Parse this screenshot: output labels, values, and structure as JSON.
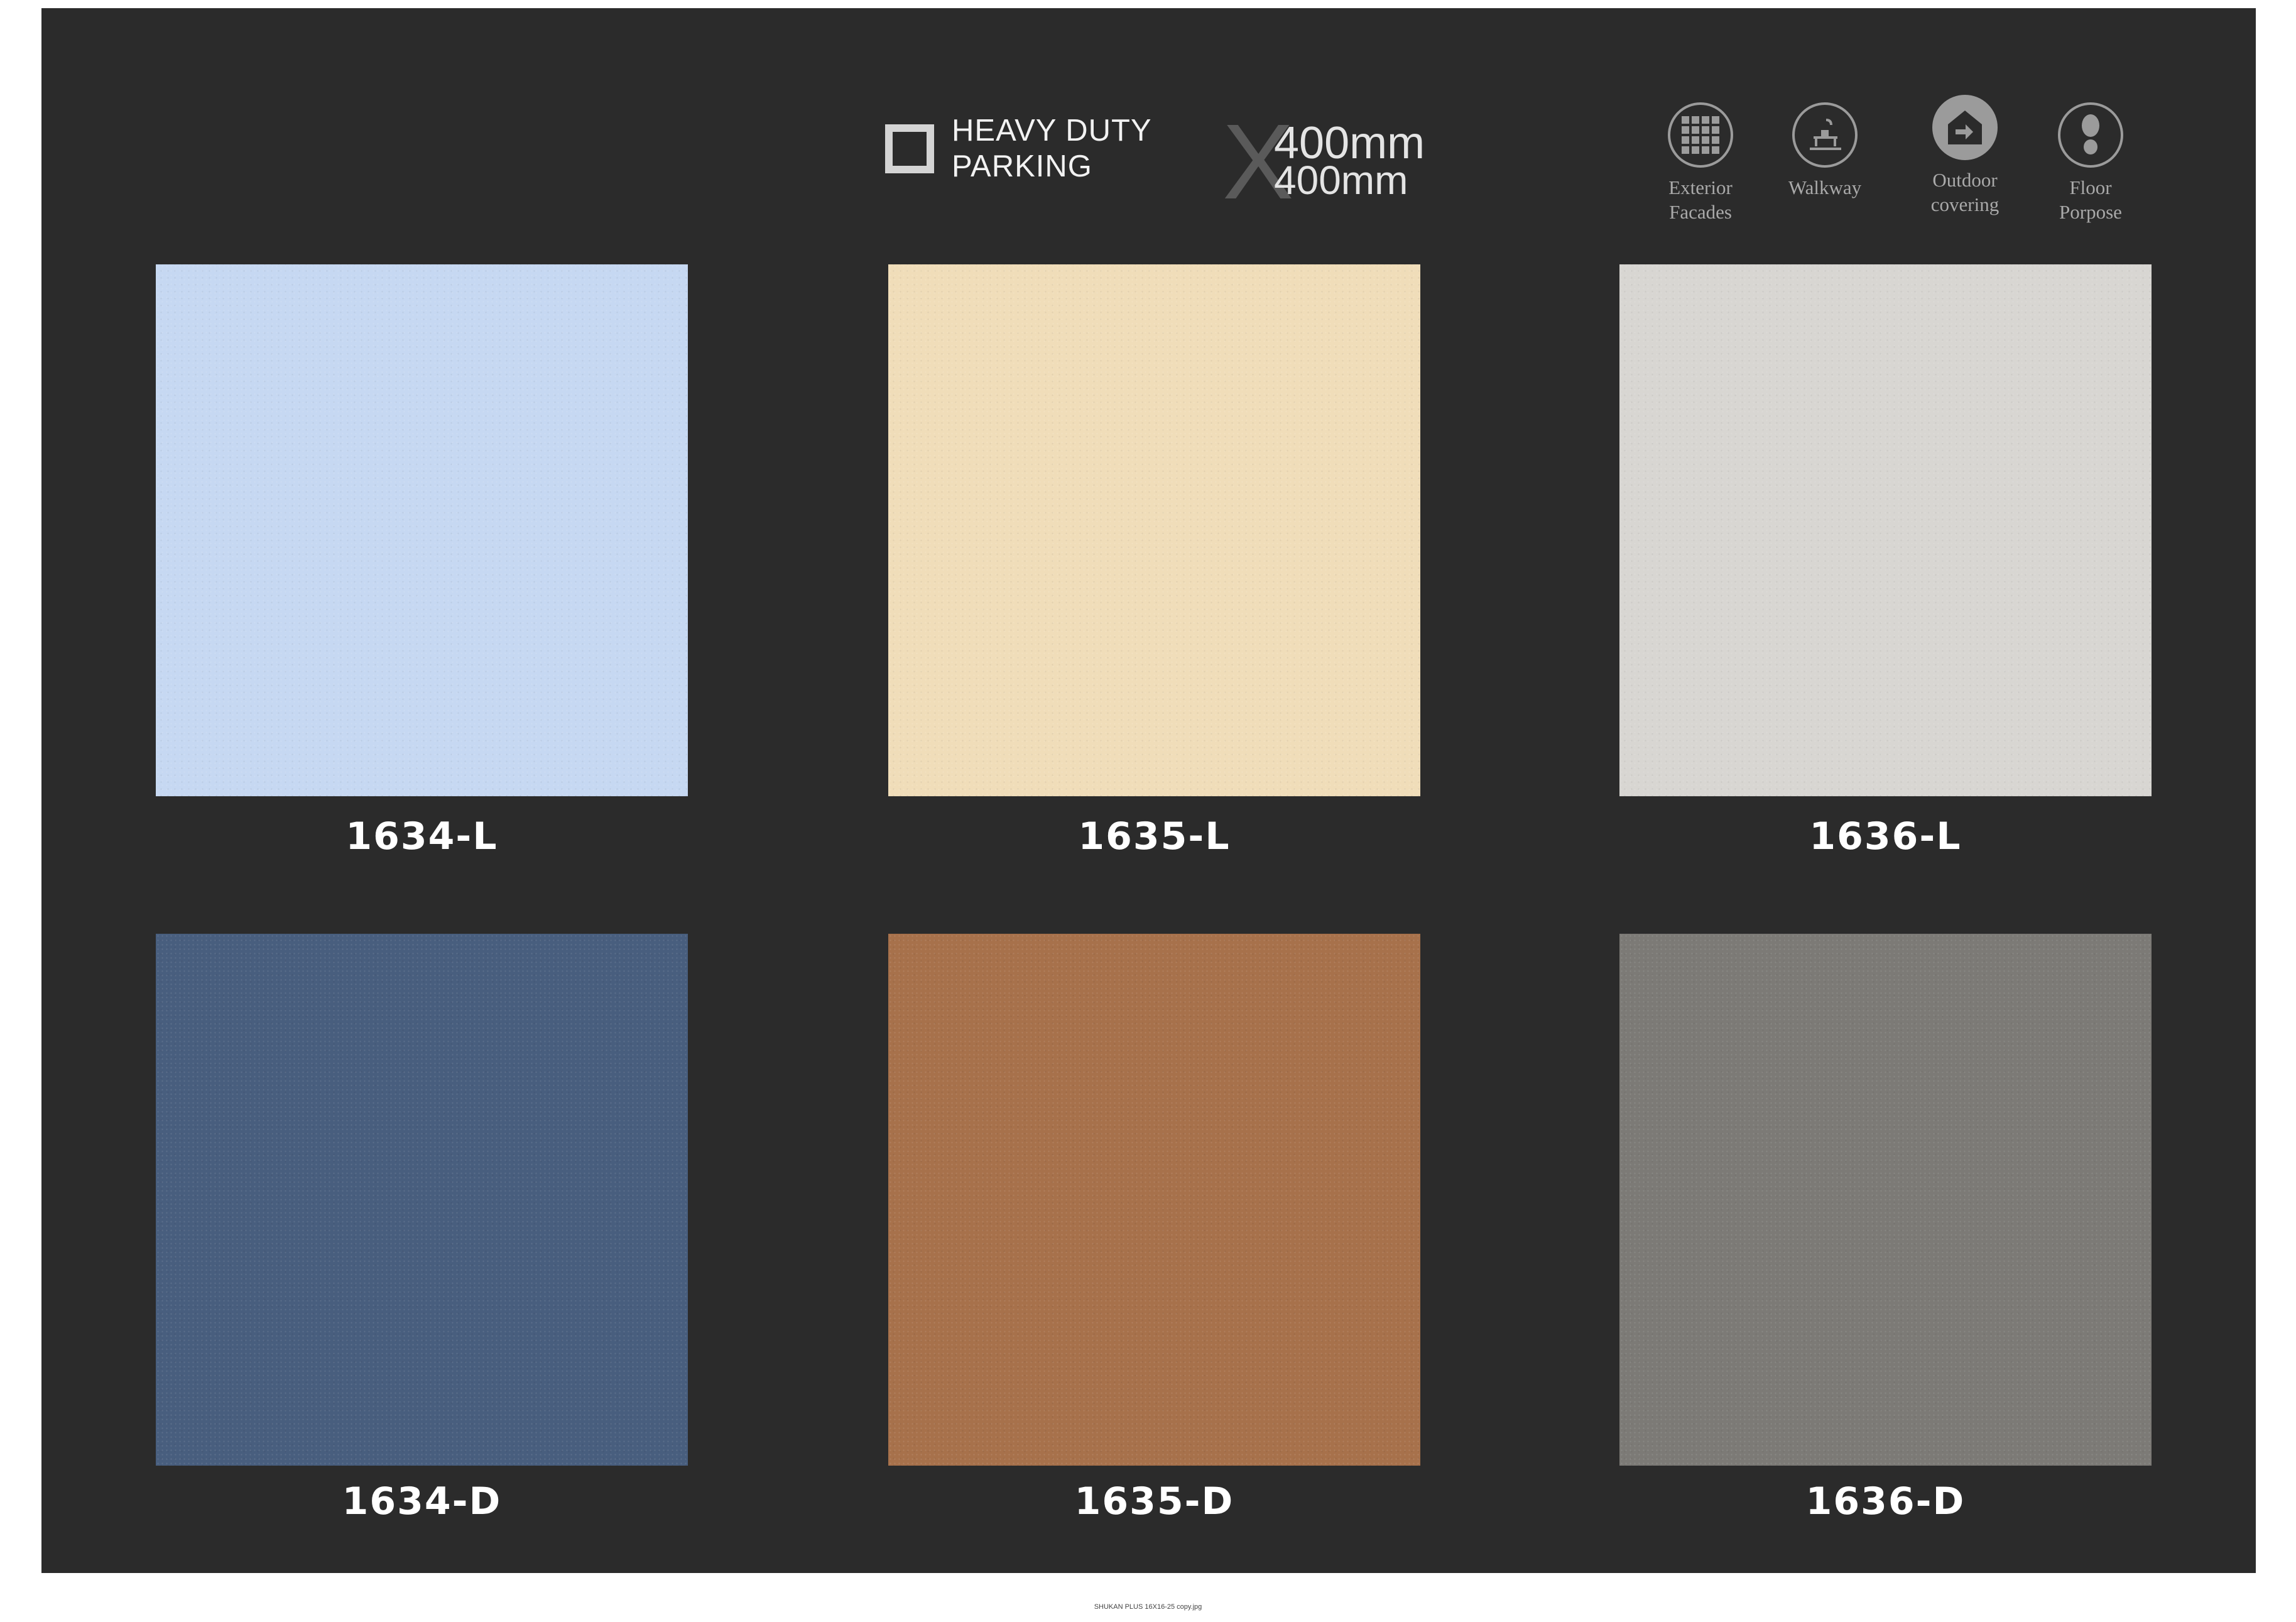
{
  "header": {
    "badge_line1": "HEAVY DUTY",
    "badge_line2": "PARKING",
    "size_x": "X",
    "size_top": "400mm",
    "size_bottom": "400mm"
  },
  "usage": [
    {
      "label_line1": "Exterior",
      "label_line2": "Facades",
      "icon": "grid-icon"
    },
    {
      "label_line1": "Walkway",
      "label_line2": "",
      "icon": "walkway-icon"
    },
    {
      "label_line1": "Outdoor",
      "label_line2": "covering",
      "icon": "outdoor-house-icon"
    },
    {
      "label_line1": "Floor",
      "label_line2": "Porpose",
      "icon": "footprint-icon"
    }
  ],
  "tiles": [
    {
      "code": "1634-L",
      "color": "#c6d8f2"
    },
    {
      "code": "1635-L",
      "color": "#f0ddb9"
    },
    {
      "code": "1636-L",
      "color": "#d8d6d2"
    },
    {
      "code": "1634-D",
      "color": "#485e7e"
    },
    {
      "code": "1635-D",
      "color": "#a7714b"
    },
    {
      "code": "1636-D",
      "color": "#7c7a76"
    }
  ],
  "footer": {
    "filename": "SHUKAN PLUS 16X16-25 copy.jpg"
  },
  "colors": {
    "background": "#2b2b2b",
    "page": "#ffffff"
  }
}
